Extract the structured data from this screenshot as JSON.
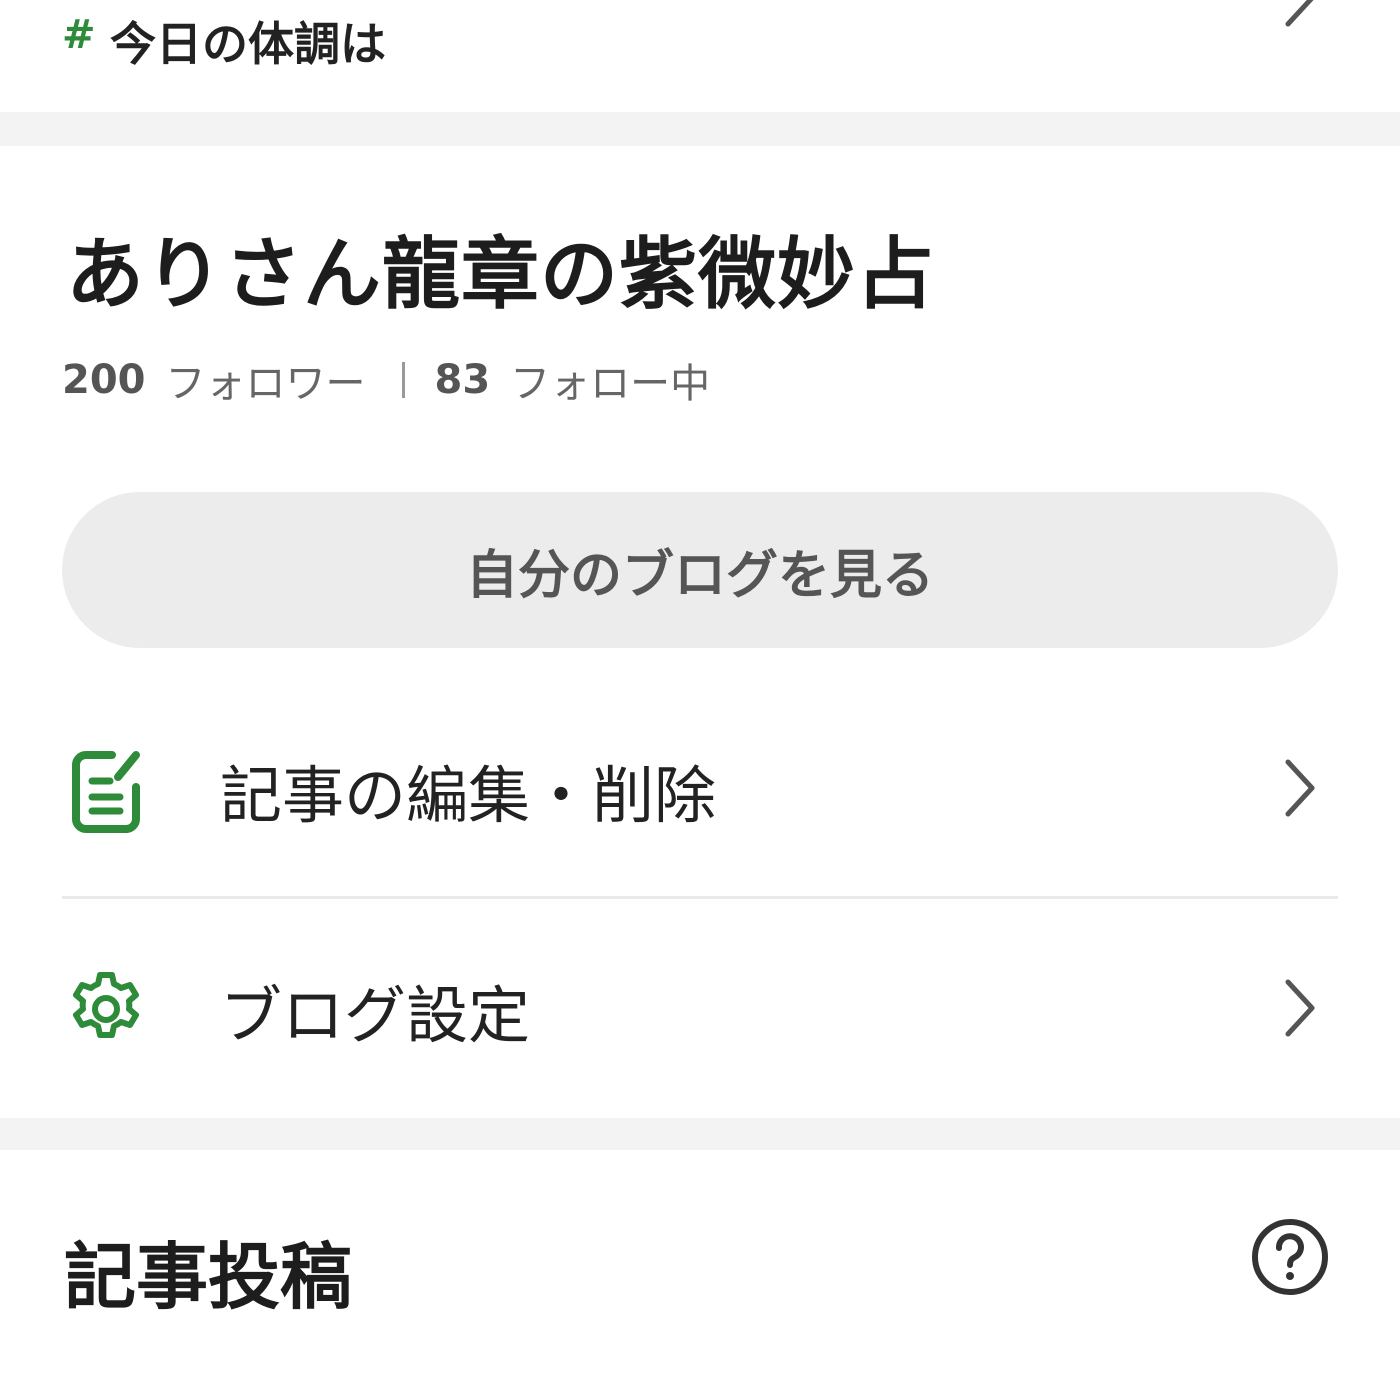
{
  "hashtag": {
    "symbol": "#",
    "text": "今日の体調は"
  },
  "profile": {
    "blog_title": "ありさん龍章の紫微妙占",
    "followers_count": "200",
    "followers_label": "フォロワー",
    "following_count": "83",
    "following_label": "フォロー中",
    "view_blog_button": "自分のブログを見る"
  },
  "menu": {
    "items": [
      {
        "label": "記事の編集・削除",
        "icon": "edit-document-icon"
      },
      {
        "label": "ブログ設定",
        "icon": "gear-icon"
      }
    ]
  },
  "post_section": {
    "title": "記事投稿",
    "help_icon": "help-circle-icon"
  },
  "colors": {
    "accent": "#2e8b3a",
    "button_bg": "#ececec",
    "band": "#f2f3f2"
  }
}
